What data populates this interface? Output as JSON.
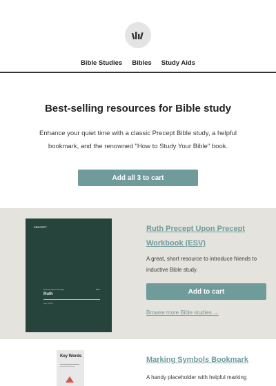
{
  "logo": {
    "icon": "books-logo-icon"
  },
  "nav": {
    "items": [
      "Bible Studies",
      "Bibles",
      "Study Aids"
    ]
  },
  "hero": {
    "title": "Best-selling resources for Bible study",
    "subtitle": "Enhance your quiet time with a classic Precept Bible study, a helpful bookmark, and the renowned \"How to Study Your Bible\" book.",
    "button": "Add all 3 to cart"
  },
  "products": [
    {
      "title": "Ruth Precept Upon Precept Workbook (ESV)",
      "description": "A great, short resource to introduce friends to inductive Bible study.",
      "button": "Add to cart",
      "link": "Browse more Bible studies →",
      "cover": {
        "brand": "PRECEPT",
        "series": "Precept Upon Precept",
        "volume": "ESV",
        "title": "Ruth",
        "author": "Kay Arthur"
      }
    },
    {
      "title": "Marking Symbols Bookmark",
      "description": "A handy placeholder with helpful marking suggestions.",
      "cover": {
        "title": "Key Words"
      }
    }
  ],
  "colors": {
    "accent": "#6f9b9b",
    "band": "#e5e3de",
    "book": "#26443b"
  }
}
